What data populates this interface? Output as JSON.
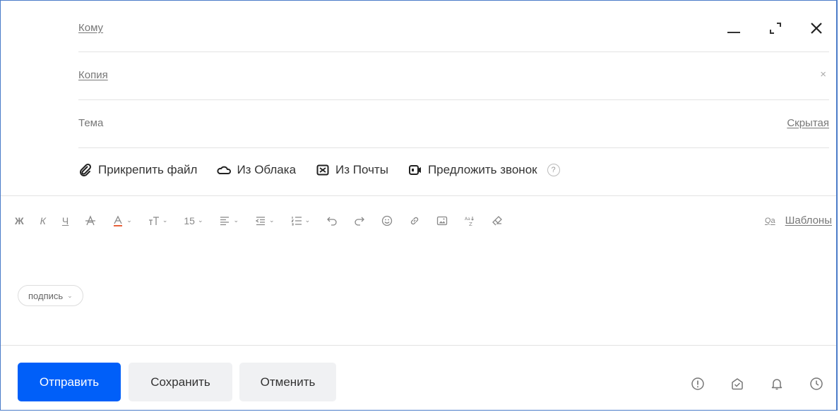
{
  "header": {
    "to_label": "Кому",
    "cc_label": "Копия",
    "cc_remove": "×",
    "subject_placeholder": "Тема",
    "bcc_label": "Скрытая"
  },
  "window_controls": [
    "minimize-icon",
    "expand-icon",
    "close-icon"
  ],
  "attachments": {
    "attach_file": "Прикрепить файл",
    "from_cloud": "Из Облака",
    "from_mail": "Из Почты",
    "suggest_call": "Предложить звонок",
    "help": "?"
  },
  "toolbar": {
    "bold": "Ж",
    "italic": "К",
    "underline": "Ч",
    "font_size": "15",
    "templates_badge": "Qa",
    "templates": "Шаблоны"
  },
  "signature": {
    "label": "подпись"
  },
  "footer": {
    "send": "Отправить",
    "save": "Сохранить",
    "cancel": "Отменить"
  },
  "colors": {
    "primary": "#005ff9",
    "border": "#4a7bc8",
    "text_color_underline": "#e8613a"
  }
}
